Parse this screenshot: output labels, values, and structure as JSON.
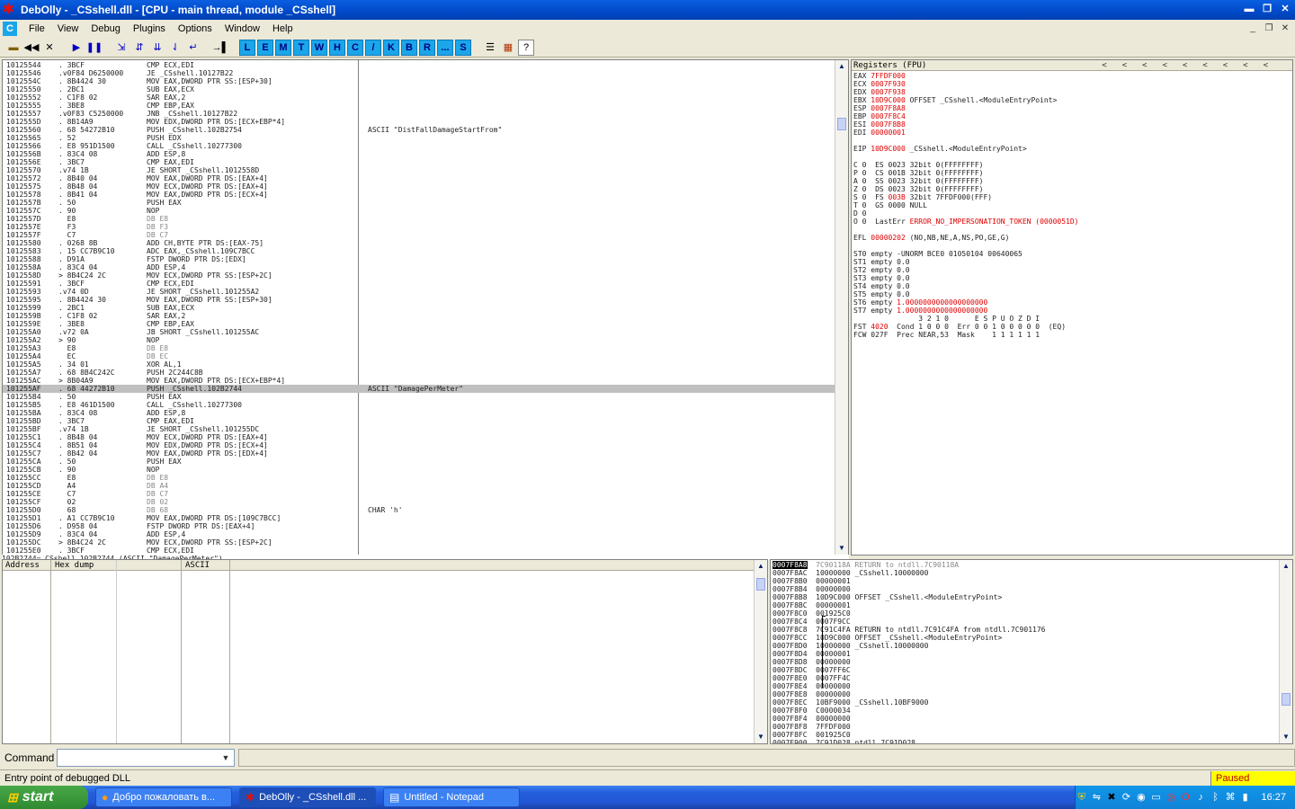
{
  "window": {
    "title": "DebOlly - _CSshell.dll - [CPU - main thread, module _CSshell]"
  },
  "menu": [
    "File",
    "View",
    "Debug",
    "Plugins",
    "Options",
    "Window",
    "Help"
  ],
  "toolbar": {
    "letters": [
      "L",
      "E",
      "M",
      "T",
      "W",
      "H",
      "C",
      "/",
      "K",
      "B",
      "R",
      "...",
      "S"
    ]
  },
  "cpu": {
    "rows": [
      {
        "a": "10125544",
        "h": ". 3BCF",
        "i": "CMP ECX,EDI",
        "c": ""
      },
      {
        "a": "10125546",
        "h": ".v0F84 D6250000",
        "i": "JE _CSshell.10127B22",
        "c": ""
      },
      {
        "a": "1012554C",
        "h": ". 8B4424 30",
        "i": "MOV EAX,DWORD PTR SS:[ESP+30]",
        "c": ""
      },
      {
        "a": "10125550",
        "h": ". 2BC1",
        "i": "SUB EAX,ECX",
        "c": ""
      },
      {
        "a": "10125552",
        "h": ". C1F8 02",
        "i": "SAR EAX,2",
        "c": ""
      },
      {
        "a": "10125555",
        "h": ". 3BE8",
        "i": "CMP EBP,EAX",
        "c": ""
      },
      {
        "a": "10125557",
        "h": ".v0F83 C5250000",
        "i": "JNB _CSshell.10127B22",
        "c": ""
      },
      {
        "a": "1012555D",
        "h": ". 8B14A9",
        "i": "MOV EDX,DWORD PTR DS:[ECX+EBP*4]",
        "c": ""
      },
      {
        "a": "10125560",
        "h": ". 68 54272B10",
        "i": "PUSH _CSshell.102B2754",
        "c": "ASCII \"DistFallDamageStartFrom\""
      },
      {
        "a": "10125565",
        "h": ". 52",
        "i": "PUSH EDX",
        "c": ""
      },
      {
        "a": "10125566",
        "h": ". E8 951D1500",
        "i": "CALL _CSshell.10277300",
        "c": ""
      },
      {
        "a": "1012556B",
        "h": ". 83C4 08",
        "i": "ADD ESP,8",
        "c": ""
      },
      {
        "a": "1012556E",
        "h": ". 3BC7",
        "i": "CMP EAX,EDI",
        "c": ""
      },
      {
        "a": "10125570",
        "h": ".v74 1B",
        "i": "JE SHORT _CSshell.1012558D",
        "c": ""
      },
      {
        "a": "10125572",
        "h": ". 8B40 04",
        "i": "MOV EAX,DWORD PTR DS:[EAX+4]",
        "c": ""
      },
      {
        "a": "10125575",
        "h": ". 8B48 04",
        "i": "MOV ECX,DWORD PTR DS:[EAX+4]",
        "c": ""
      },
      {
        "a": "10125578",
        "h": ". 8B41 04",
        "i": "MOV EAX,DWORD PTR DS:[ECX+4]",
        "c": ""
      },
      {
        "a": "1012557B",
        "h": ". 50",
        "i": "PUSH EAX",
        "c": ""
      },
      {
        "a": "1012557C",
        "h": ". 90",
        "i": "NOP",
        "c": ""
      },
      {
        "a": "1012557D",
        "h": "  E8",
        "i": "DB E8",
        "c": "",
        "g": 1
      },
      {
        "a": "1012557E",
        "h": "  F3",
        "i": "DB F3",
        "c": "",
        "g": 1
      },
      {
        "a": "1012557F",
        "h": "  C7",
        "i": "DB C7",
        "c": "",
        "g": 1
      },
      {
        "a": "10125580",
        "h": ". 0268 8B",
        "i": "ADD CH,BYTE PTR DS:[EAX-75]",
        "c": ""
      },
      {
        "a": "10125583",
        "h": ". 15 CC7B9C10",
        "i": "ADC EAX,_CSshell.109C7BCC",
        "c": ""
      },
      {
        "a": "10125588",
        "h": ". D91A",
        "i": "FSTP DWORD PTR DS:[EDX]",
        "c": ""
      },
      {
        "a": "1012558A",
        "h": ". 83C4 04",
        "i": "ADD ESP,4",
        "c": ""
      },
      {
        "a": "1012558D",
        "h": "> 8B4C24 2C",
        "i": "MOV ECX,DWORD PTR SS:[ESP+2C]",
        "c": ""
      },
      {
        "a": "10125591",
        "h": ". 3BCF",
        "i": "CMP ECX,EDI",
        "c": ""
      },
      {
        "a": "10125593",
        "h": ".v74 0D",
        "i": "JE SHORT _CSshell.101255A2",
        "c": ""
      },
      {
        "a": "10125595",
        "h": ". 8B4424 30",
        "i": "MOV EAX,DWORD PTR SS:[ESP+30]",
        "c": ""
      },
      {
        "a": "10125599",
        "h": ". 2BC1",
        "i": "SUB EAX,ECX",
        "c": ""
      },
      {
        "a": "1012559B",
        "h": ". C1F8 02",
        "i": "SAR EAX,2",
        "c": ""
      },
      {
        "a": "1012559E",
        "h": ". 3BE8",
        "i": "CMP EBP,EAX",
        "c": ""
      },
      {
        "a": "101255A0",
        "h": ".v72 0A",
        "i": "JB SHORT _CSshell.101255AC",
        "c": ""
      },
      {
        "a": "101255A2",
        "h": "> 90",
        "i": "NOP",
        "c": ""
      },
      {
        "a": "101255A3",
        "h": "  E8",
        "i": "DB E8",
        "c": "",
        "g": 1
      },
      {
        "a": "101255A4",
        "h": "  EC",
        "i": "DB EC",
        "c": "",
        "g": 1
      },
      {
        "a": "101255A5",
        "h": ". 34 01",
        "i": "XOR AL,1",
        "c": ""
      },
      {
        "a": "101255A7",
        "h": ". 68 8B4C242C",
        "i": "PUSH 2C244C8B",
        "c": ""
      },
      {
        "a": "101255AC",
        "h": "> 8B04A9",
        "i": "MOV EAX,DWORD PTR DS:[ECX+EBP*4]",
        "c": ""
      },
      {
        "a": "101255AF",
        "h": ". 68 44272B10",
        "i": "PUSH _CSshell.102B2744",
        "c": "ASCII \"DamagePerMeter\"",
        "sel": 1
      },
      {
        "a": "101255B4",
        "h": ". 50",
        "i": "PUSH EAX",
        "c": ""
      },
      {
        "a": "101255B5",
        "h": ". E8 461D1500",
        "i": "CALL _CSshell.10277300",
        "c": ""
      },
      {
        "a": "101255BA",
        "h": ". 83C4 08",
        "i": "ADD ESP,8",
        "c": ""
      },
      {
        "a": "101255BD",
        "h": ". 3BC7",
        "i": "CMP EAX,EDI",
        "c": ""
      },
      {
        "a": "101255BF",
        "h": ".v74 1B",
        "i": "JE SHORT _CSshell.101255DC",
        "c": ""
      },
      {
        "a": "101255C1",
        "h": ". 8B48 04",
        "i": "MOV ECX,DWORD PTR DS:[EAX+4]",
        "c": ""
      },
      {
        "a": "101255C4",
        "h": ". 8B51 04",
        "i": "MOV EDX,DWORD PTR DS:[ECX+4]",
        "c": ""
      },
      {
        "a": "101255C7",
        "h": ". 8B42 04",
        "i": "MOV EAX,DWORD PTR DS:[EDX+4]",
        "c": ""
      },
      {
        "a": "101255CA",
        "h": ". 50",
        "i": "PUSH EAX",
        "c": ""
      },
      {
        "a": "101255CB",
        "h": ". 90",
        "i": "NOP",
        "c": ""
      },
      {
        "a": "101255CC",
        "h": "  E8",
        "i": "DB E8",
        "c": "",
        "g": 1
      },
      {
        "a": "101255CD",
        "h": "  A4",
        "i": "DB A4",
        "c": "",
        "g": 1
      },
      {
        "a": "101255CE",
        "h": "  C7",
        "i": "DB C7",
        "c": "",
        "g": 1
      },
      {
        "a": "101255CF",
        "h": "  02",
        "i": "DB 02",
        "c": "",
        "g": 1
      },
      {
        "a": "101255D0",
        "h": "  68",
        "i": "DB 68",
        "c": "CHAR 'h'",
        "g": 1
      },
      {
        "a": "101255D1",
        "h": ". A1 CC7B9C10",
        "i": "MOV EAX,DWORD PTR DS:[109C7BCC]",
        "c": ""
      },
      {
        "a": "101255D6",
        "h": ". D958 04",
        "i": "FSTP DWORD PTR DS:[EAX+4]",
        "c": ""
      },
      {
        "a": "101255D9",
        "h": ". 83C4 04",
        "i": "ADD ESP,4",
        "c": ""
      },
      {
        "a": "101255DC",
        "h": "> 8B4C24 2C",
        "i": "MOV ECX,DWORD PTR SS:[ESP+2C]",
        "c": ""
      },
      {
        "a": "101255E0",
        "h": ". 3BCF",
        "i": "CMP ECX,EDI",
        "c": ""
      }
    ],
    "info": "102B2744=_CSshell.102B2744 (ASCII \"DamagePerMeter\")"
  },
  "registers": {
    "header": "Registers (FPU)",
    "lines": [
      {
        "t": "EAX ",
        "v": "7FFDF000",
        "r": ""
      },
      {
        "t": "ECX ",
        "v": "0007F930",
        "r": ""
      },
      {
        "t": "EDX ",
        "v": "0007F938",
        "r": ""
      },
      {
        "t": "EBX ",
        "v": "10D9C000",
        "r": " OFFSET _CSshell.<ModuleEntryPoint>"
      },
      {
        "t": "ESP ",
        "v": "0007F8A8",
        "r": ""
      },
      {
        "t": "EBP ",
        "v": "0007F8C4",
        "r": ""
      },
      {
        "t": "ESI ",
        "v": "0007F8B8",
        "r": ""
      },
      {
        "t": "EDI ",
        "v": "00000001",
        "r": ""
      },
      {
        "t": "",
        "v": "",
        "r": ""
      },
      {
        "t": "EIP ",
        "v": "10D9C000",
        "r": " _CSshell.<ModuleEntryPoint>"
      },
      {
        "t": "",
        "v": "",
        "r": ""
      },
      {
        "t": "C 0  ES 0023 32bit 0(FFFFFFFF)",
        "v": "",
        "r": ""
      },
      {
        "t": "P 0  CS 001B 32bit 0(FFFFFFFF)",
        "v": "",
        "r": ""
      },
      {
        "t": "A 0  SS 0023 32bit 0(FFFFFFFF)",
        "v": "",
        "r": ""
      },
      {
        "t": "Z 0  DS 0023 32bit 0(FFFFFFFF)",
        "v": "",
        "r": ""
      },
      {
        "t": "S 0  FS ",
        "v": "003B",
        "r": " 32bit 7FFDF000(FFF)"
      },
      {
        "t": "T 0  GS 0000 NULL",
        "v": "",
        "r": ""
      },
      {
        "t": "D 0",
        "v": "",
        "r": ""
      },
      {
        "t": "O 0  LastErr ",
        "v": "ERROR_NO_IMPERSONATION_TOKEN (0000051D)",
        "r": ""
      },
      {
        "t": "",
        "v": "",
        "r": ""
      },
      {
        "t": "EFL ",
        "v": "00000202",
        "r": " (NO,NB,NE,A,NS,PO,GE,G)"
      },
      {
        "t": "",
        "v": "",
        "r": ""
      },
      {
        "t": "ST0 empty -UNORM BCE0 01050104 00640065",
        "v": "",
        "r": ""
      },
      {
        "t": "ST1 empty 0.0",
        "v": "",
        "r": ""
      },
      {
        "t": "ST2 empty 0.0",
        "v": "",
        "r": ""
      },
      {
        "t": "ST3 empty 0.0",
        "v": "",
        "r": ""
      },
      {
        "t": "ST4 empty 0.0",
        "v": "",
        "r": ""
      },
      {
        "t": "ST5 empty 0.0",
        "v": "",
        "r": ""
      },
      {
        "t": "ST6 empty ",
        "v": "1.0000000000000000000",
        "r": ""
      },
      {
        "t": "ST7 empty ",
        "v": "1.0000000000000000000",
        "r": ""
      },
      {
        "t": "               3 2 1 0      E S P U O Z D I",
        "v": "",
        "r": ""
      },
      {
        "t": "FST ",
        "v": "4020",
        "r": "  Cond 1 0 0 0  Err 0 0 1 0 0 0 0 0  (EQ)"
      },
      {
        "t": "FCW 027F  Prec NEAR,53  Mask    1 1 1 1 1 1",
        "v": "",
        "r": ""
      }
    ]
  },
  "dump": {
    "headers": [
      "Address",
      "Hex dump",
      "ASCII"
    ]
  },
  "stack": {
    "rows": [
      {
        "a": "0007F8A8",
        "v": "7C90118A",
        "c": "RETURN to ntdll.7C90118A",
        "sel": 1
      },
      {
        "a": "0007F8AC",
        "v": "10000000",
        "c": "_CSshell.10000000"
      },
      {
        "a": "0007F8B0",
        "v": "00000001",
        "c": ""
      },
      {
        "a": "0007F8B4",
        "v": "00000000",
        "c": ""
      },
      {
        "a": "0007F8B8",
        "v": "10D9C000",
        "c": "OFFSET _CSshell.<ModuleEntryPoint>"
      },
      {
        "a": "0007F8BC",
        "v": "00000001",
        "c": ""
      },
      {
        "a": "0007F8C0",
        "v": "001925C0",
        "c": ""
      },
      {
        "a": "0007F8C4",
        "v": "0007F9CC",
        "c": ""
      },
      {
        "a": "0007F8C8",
        "v": "7C91C4FA",
        "c": "RETURN to ntdll.7C91C4FA from ntdll.7C901176"
      },
      {
        "a": "0007F8CC",
        "v": "10D9C000",
        "c": "OFFSET _CSshell.<ModuleEntryPoint>"
      },
      {
        "a": "0007F8D0",
        "v": "10000000",
        "c": "_CSshell.10000000"
      },
      {
        "a": "0007F8D4",
        "v": "00000001",
        "c": ""
      },
      {
        "a": "0007F8D8",
        "v": "00000000",
        "c": ""
      },
      {
        "a": "0007F8DC",
        "v": "0007FF6C",
        "c": ""
      },
      {
        "a": "0007F8E0",
        "v": "0007FF4C",
        "c": ""
      },
      {
        "a": "0007F8E4",
        "v": "00000000",
        "c": ""
      },
      {
        "a": "0007F8E8",
        "v": "00000000",
        "c": ""
      },
      {
        "a": "0007F8EC",
        "v": "10BF9000",
        "c": "_CSshell.10BF9000"
      },
      {
        "a": "0007F8F0",
        "v": "C0000034",
        "c": ""
      },
      {
        "a": "0007F8F4",
        "v": "00000000",
        "c": ""
      },
      {
        "a": "0007F8F8",
        "v": "7FFDF000",
        "c": ""
      },
      {
        "a": "0007F8FC",
        "v": "001925C0",
        "c": ""
      },
      {
        "a": "0007F900",
        "v": "7C91D028",
        "c": "ntdll.7C91D028"
      }
    ]
  },
  "command": {
    "label": "Command",
    "value": ""
  },
  "status": {
    "message": "Entry point of debugged DLL",
    "state": "Paused"
  },
  "taskbar": {
    "start": "start",
    "tasks": [
      "Добро пожаловать в...",
      "DebOlly - _CSshell.dll ...",
      "Untitled - Notepad"
    ],
    "clock": "16:27"
  },
  "colors": {
    "accent_red": "#e00000",
    "paused_bg": "#ffff00",
    "title_blue": "#0049c8",
    "toolbar_cyan": "#1aa6e8"
  }
}
